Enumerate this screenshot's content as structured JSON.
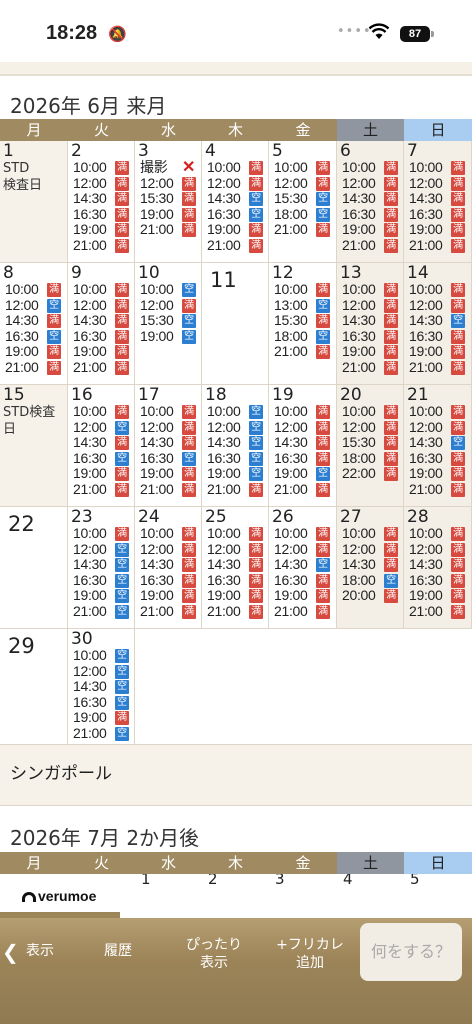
{
  "status": {
    "time": "18:28",
    "battery": "87"
  },
  "months": [
    {
      "title": "2026年 6月 来月"
    },
    {
      "title": "2026年 7月 2か月後"
    }
  ],
  "weekdays": [
    "月",
    "火",
    "水",
    "木",
    "金",
    "土",
    "日"
  ],
  "badges": {
    "full": "満",
    "open": "空"
  },
  "days": [
    {
      "d": "1",
      "note": "STD\n検査日",
      "slots": []
    },
    {
      "d": "2",
      "slots": [
        [
          "10:00",
          "満"
        ],
        [
          "12:00",
          "満"
        ],
        [
          "14:30",
          "満"
        ],
        [
          "16:30",
          "満"
        ],
        [
          "19:00",
          "満"
        ],
        [
          "21:00",
          "満"
        ]
      ]
    },
    {
      "d": "3",
      "slots": [
        [
          "撮影",
          "x"
        ],
        [
          "12:00",
          "満"
        ],
        [
          "15:30",
          "満"
        ],
        [
          "19:00",
          "満"
        ],
        [
          "21:00",
          "満"
        ]
      ]
    },
    {
      "d": "4",
      "slots": [
        [
          "10:00",
          "満"
        ],
        [
          "12:00",
          "満"
        ],
        [
          "14:30",
          "空"
        ],
        [
          "16:30",
          "空"
        ],
        [
          "19:00",
          "満"
        ],
        [
          "21:00",
          "満"
        ]
      ]
    },
    {
      "d": "5",
      "slots": [
        [
          "10:00",
          "満"
        ],
        [
          "12:00",
          "満"
        ],
        [
          "15:30",
          "空"
        ],
        [
          "18:00",
          "空"
        ],
        [
          "21:00",
          "満"
        ]
      ]
    },
    {
      "d": "6",
      "slots": [
        [
          "10:00",
          "満"
        ],
        [
          "12:00",
          "満"
        ],
        [
          "14:30",
          "満"
        ],
        [
          "16:30",
          "満"
        ],
        [
          "19:00",
          "満"
        ],
        [
          "21:00",
          "満"
        ]
      ]
    },
    {
      "d": "7",
      "slots": [
        [
          "10:00",
          "満"
        ],
        [
          "12:00",
          "満"
        ],
        [
          "14:30",
          "満"
        ],
        [
          "16:30",
          "満"
        ],
        [
          "19:00",
          "満"
        ],
        [
          "21:00",
          "満"
        ]
      ]
    },
    {
      "d": "8",
      "slots": [
        [
          "10:00",
          "満"
        ],
        [
          "12:00",
          "空"
        ],
        [
          "14:30",
          "満"
        ],
        [
          "16:30",
          "空"
        ],
        [
          "19:00",
          "満"
        ],
        [
          "21:00",
          "満"
        ]
      ]
    },
    {
      "d": "9",
      "slots": [
        [
          "10:00",
          "満"
        ],
        [
          "12:00",
          "満"
        ],
        [
          "14:30",
          "満"
        ],
        [
          "16:30",
          "満"
        ],
        [
          "19:00",
          "満"
        ],
        [
          "21:00",
          "満"
        ]
      ]
    },
    {
      "d": "10",
      "slots": [
        [
          "10:00",
          "空"
        ],
        [
          "12:00",
          "満"
        ],
        [
          "15:30",
          "空"
        ],
        [
          "19:00",
          "空"
        ]
      ]
    },
    {
      "d": "11",
      "big": true,
      "slots": []
    },
    {
      "d": "12",
      "slots": [
        [
          "10:00",
          "満"
        ],
        [
          "13:00",
          "空"
        ],
        [
          "15:30",
          "満"
        ],
        [
          "18:00",
          "空"
        ],
        [
          "21:00",
          "満"
        ]
      ]
    },
    {
      "d": "13",
      "slots": [
        [
          "10:00",
          "満"
        ],
        [
          "12:00",
          "満"
        ],
        [
          "14:30",
          "満"
        ],
        [
          "16:30",
          "満"
        ],
        [
          "19:00",
          "満"
        ],
        [
          "21:00",
          "満"
        ]
      ]
    },
    {
      "d": "14",
      "slots": [
        [
          "10:00",
          "満"
        ],
        [
          "12:00",
          "満"
        ],
        [
          "14:30",
          "空"
        ],
        [
          "16:30",
          "満"
        ],
        [
          "19:00",
          "満"
        ],
        [
          "21:00",
          "満"
        ]
      ]
    },
    {
      "d": "15",
      "note": "STD検査\n日",
      "slots": []
    },
    {
      "d": "16",
      "slots": [
        [
          "10:00",
          "満"
        ],
        [
          "12:00",
          "空"
        ],
        [
          "14:30",
          "満"
        ],
        [
          "16:30",
          "空"
        ],
        [
          "19:00",
          "満"
        ],
        [
          "21:00",
          "満"
        ]
      ]
    },
    {
      "d": "17",
      "slots": [
        [
          "10:00",
          "満"
        ],
        [
          "12:00",
          "満"
        ],
        [
          "14:30",
          "満"
        ],
        [
          "16:30",
          "空"
        ],
        [
          "19:00",
          "満"
        ],
        [
          "21:00",
          "満"
        ]
      ]
    },
    {
      "d": "18",
      "slots": [
        [
          "10:00",
          "空"
        ],
        [
          "12:00",
          "空"
        ],
        [
          "14:30",
          "空"
        ],
        [
          "16:30",
          "空"
        ],
        [
          "19:00",
          "空"
        ],
        [
          "21:00",
          "満"
        ]
      ]
    },
    {
      "d": "19",
      "slots": [
        [
          "10:00",
          "満"
        ],
        [
          "12:00",
          "満"
        ],
        [
          "14:30",
          "満"
        ],
        [
          "16:30",
          "満"
        ],
        [
          "19:00",
          "空"
        ],
        [
          "21:00",
          "満"
        ]
      ]
    },
    {
      "d": "20",
      "slots": [
        [
          "10:00",
          "満"
        ],
        [
          "12:00",
          "満"
        ],
        [
          "15:30",
          "満"
        ],
        [
          "18:00",
          "満"
        ],
        [
          "22:00",
          "満"
        ]
      ]
    },
    {
      "d": "21",
      "slots": [
        [
          "10:00",
          "満"
        ],
        [
          "12:00",
          "満"
        ],
        [
          "14:30",
          "空"
        ],
        [
          "16:30",
          "満"
        ],
        [
          "19:00",
          "満"
        ],
        [
          "21:00",
          "満"
        ]
      ]
    },
    {
      "d": "22",
      "big": true,
      "slots": []
    },
    {
      "d": "23",
      "slots": [
        [
          "10:00",
          "満"
        ],
        [
          "12:00",
          "空"
        ],
        [
          "14:30",
          "空"
        ],
        [
          "16:30",
          "空"
        ],
        [
          "19:00",
          "空"
        ],
        [
          "21:00",
          "空"
        ]
      ]
    },
    {
      "d": "24",
      "slots": [
        [
          "10:00",
          "満"
        ],
        [
          "12:00",
          "満"
        ],
        [
          "14:30",
          "満"
        ],
        [
          "16:30",
          "満"
        ],
        [
          "19:00",
          "満"
        ],
        [
          "21:00",
          "満"
        ]
      ]
    },
    {
      "d": "25",
      "slots": [
        [
          "10:00",
          "満"
        ],
        [
          "12:00",
          "満"
        ],
        [
          "14:30",
          "満"
        ],
        [
          "16:30",
          "満"
        ],
        [
          "19:00",
          "満"
        ],
        [
          "21:00",
          "満"
        ]
      ]
    },
    {
      "d": "26",
      "slots": [
        [
          "10:00",
          "満"
        ],
        [
          "12:00",
          "満"
        ],
        [
          "14:30",
          "空"
        ],
        [
          "16:30",
          "満"
        ],
        [
          "19:00",
          "満"
        ],
        [
          "21:00",
          "満"
        ]
      ]
    },
    {
      "d": "27",
      "slots": [
        [
          "10:00",
          "満"
        ],
        [
          "12:00",
          "満"
        ],
        [
          "14:30",
          "満"
        ],
        [
          "18:00",
          "空"
        ],
        [
          "20:00",
          "満"
        ]
      ]
    },
    {
      "d": "28",
      "slots": [
        [
          "10:00",
          "満"
        ],
        [
          "12:00",
          "満"
        ],
        [
          "14:30",
          "満"
        ],
        [
          "16:30",
          "満"
        ],
        [
          "19:00",
          "満"
        ],
        [
          "21:00",
          "満"
        ]
      ]
    },
    {
      "d": "29",
      "big": true,
      "slots": []
    },
    {
      "d": "30",
      "slots": [
        [
          "10:00",
          "空"
        ],
        [
          "12:00",
          "空"
        ],
        [
          "14:30",
          "空"
        ],
        [
          "16:30",
          "空"
        ],
        [
          "19:00",
          "満"
        ],
        [
          "21:00",
          "空"
        ]
      ]
    }
  ],
  "footer_note": "シンガポール",
  "july_partial_days": [
    "1",
    "2",
    "3",
    "4",
    "5"
  ],
  "logo": "verumoe",
  "toolbar": {
    "back": "表示",
    "history": "履歴",
    "fit": "ぴったり\n表示",
    "add": "+フリカレ\n追加",
    "ask": "何をする？"
  },
  "colors": {
    "full": "#d64a3f",
    "open": "#2b7ed0",
    "header": "#a08a62",
    "sat": "#8f969f",
    "sun": "#a9cdf0"
  }
}
